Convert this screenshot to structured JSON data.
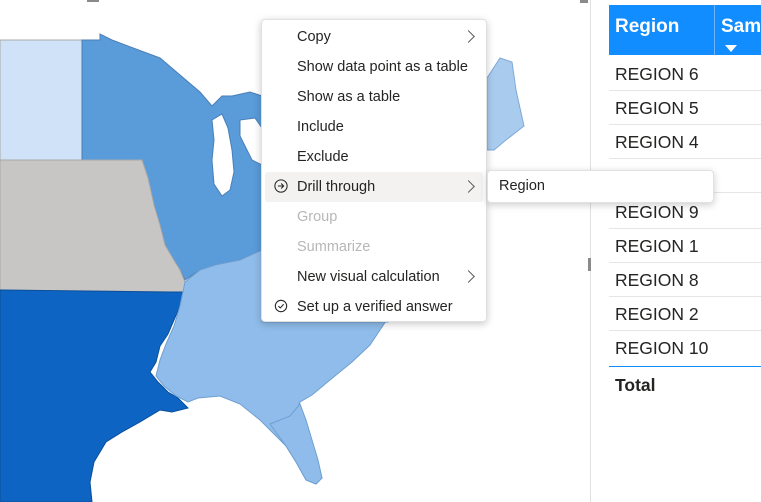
{
  "colors": {
    "map_light_blue": "#cfe2f7",
    "map_mid_blue": "#5a9bd9",
    "map_pale_blue": "#8fbcea",
    "map_dark_blue": "#0d64c2",
    "map_gray": "#c8c6c4",
    "table_header": "#118dff",
    "highlight": "#f3f2f1"
  },
  "context_menu": {
    "items": [
      {
        "label": "Copy",
        "submenu": true,
        "disabled": false
      },
      {
        "label": "Show data point as a table",
        "submenu": false,
        "disabled": false
      },
      {
        "label": "Show as a table",
        "submenu": false,
        "disabled": false
      },
      {
        "label": "Include",
        "submenu": false,
        "disabled": false
      },
      {
        "label": "Exclude",
        "submenu": false,
        "disabled": false
      },
      {
        "label": "Drill through",
        "submenu": true,
        "disabled": false,
        "icon": "drill-through-icon",
        "highlighted": true
      },
      {
        "label": "Group",
        "submenu": false,
        "disabled": true
      },
      {
        "label": "Summarize",
        "submenu": false,
        "disabled": true
      },
      {
        "label": "New visual calculation",
        "submenu": true,
        "disabled": false
      },
      {
        "label": "Set up a verified answer",
        "submenu": false,
        "disabled": false,
        "icon": "check-circle-icon"
      }
    ]
  },
  "drill_submenu": {
    "items": [
      {
        "label": "Region"
      }
    ]
  },
  "table": {
    "columns": [
      "Region",
      "Sam"
    ],
    "sort_icon": "sort-desc-icon",
    "rows": [
      "REGION 6",
      "REGION 5",
      "REGION 4",
      "",
      "REGION 9",
      "REGION 1",
      "REGION 8",
      "REGION 2",
      "REGION 10"
    ],
    "total_label": "Total"
  }
}
